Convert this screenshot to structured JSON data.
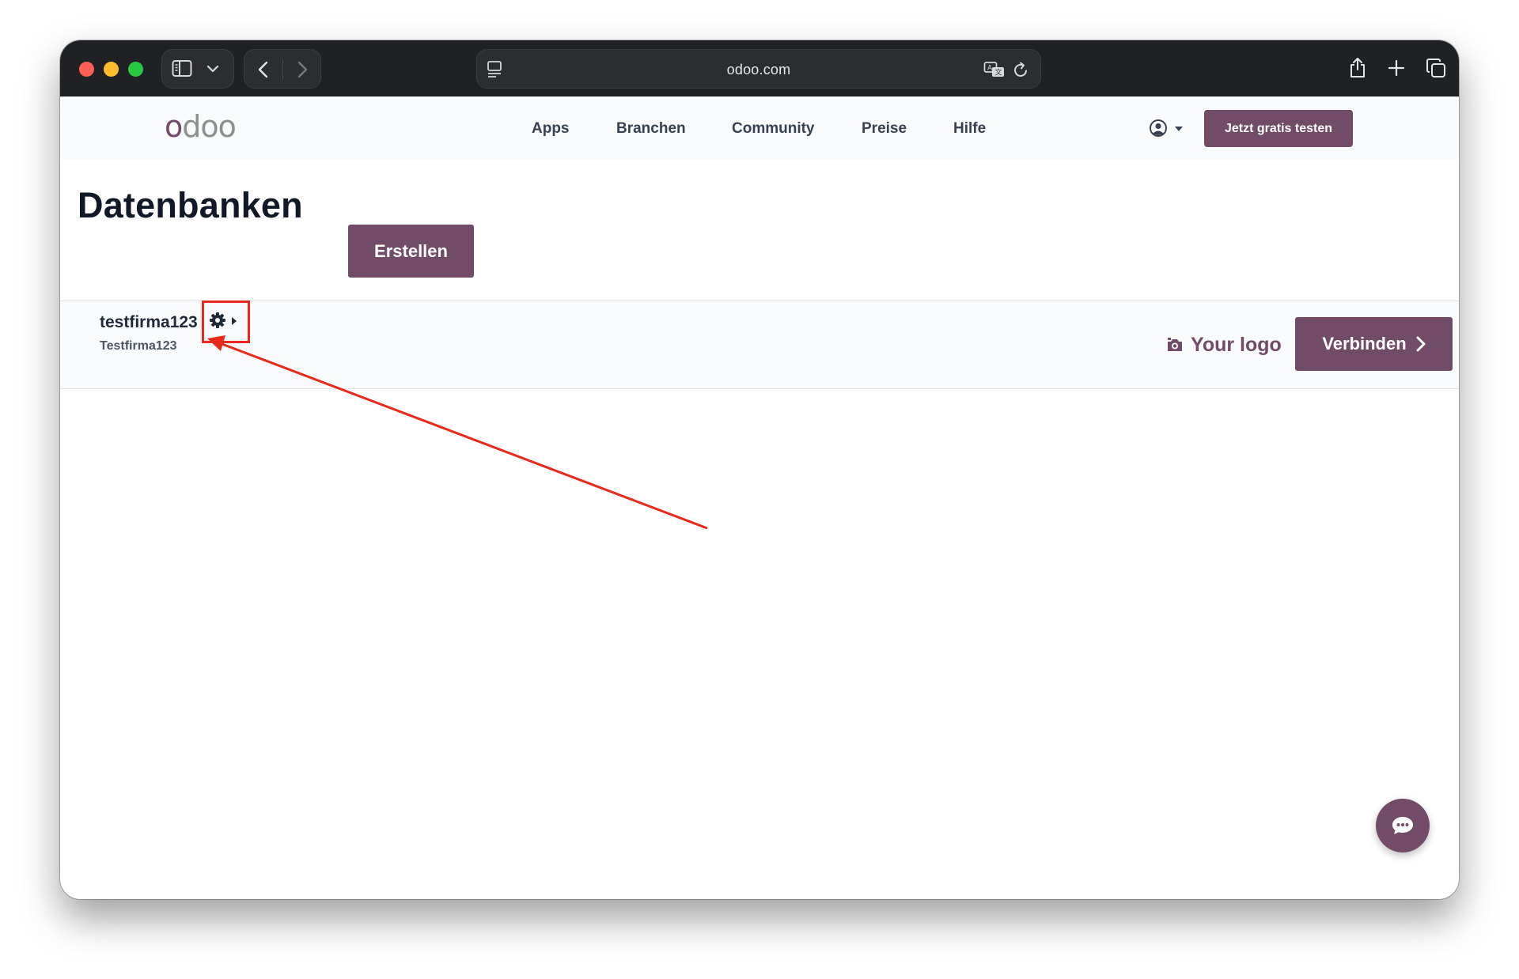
{
  "browser": {
    "url": "odoo.com",
    "colors": {
      "toolbar": "#1f2125",
      "close": "#ff5f57",
      "minimize": "#febc2e",
      "zoom": "#28c840"
    },
    "icons": [
      "sidebar-icon",
      "chevron-down-icon",
      "back-icon",
      "forward-icon",
      "page-menu-icon",
      "translate-icon",
      "reload-icon",
      "share-icon",
      "new-tab-icon",
      "tabs-overview-icon"
    ]
  },
  "site": {
    "logo": {
      "accent": "o",
      "rest": "doo"
    },
    "nav": [
      "Apps",
      "Branchen",
      "Community",
      "Preise",
      "Hilfe"
    ],
    "cta_label": "Jetzt gratis testen",
    "brand_color": "#714b67",
    "icons": [
      "user-icon",
      "caret-down-icon"
    ]
  },
  "page": {
    "title": "Datenbanken",
    "create_label": "Erstellen"
  },
  "database": {
    "name": "testfirma123",
    "subtitle": "Testfirma123",
    "logo_label": "Your logo",
    "connect_label": "Verbinden",
    "icons": [
      "gear-icon",
      "caret-right-icon",
      "camera-icon",
      "chevron-right-icon"
    ]
  },
  "annotation": {
    "color": "#e8291b",
    "target": "gear-icon"
  },
  "chat": {
    "icon": "chat-icon"
  }
}
